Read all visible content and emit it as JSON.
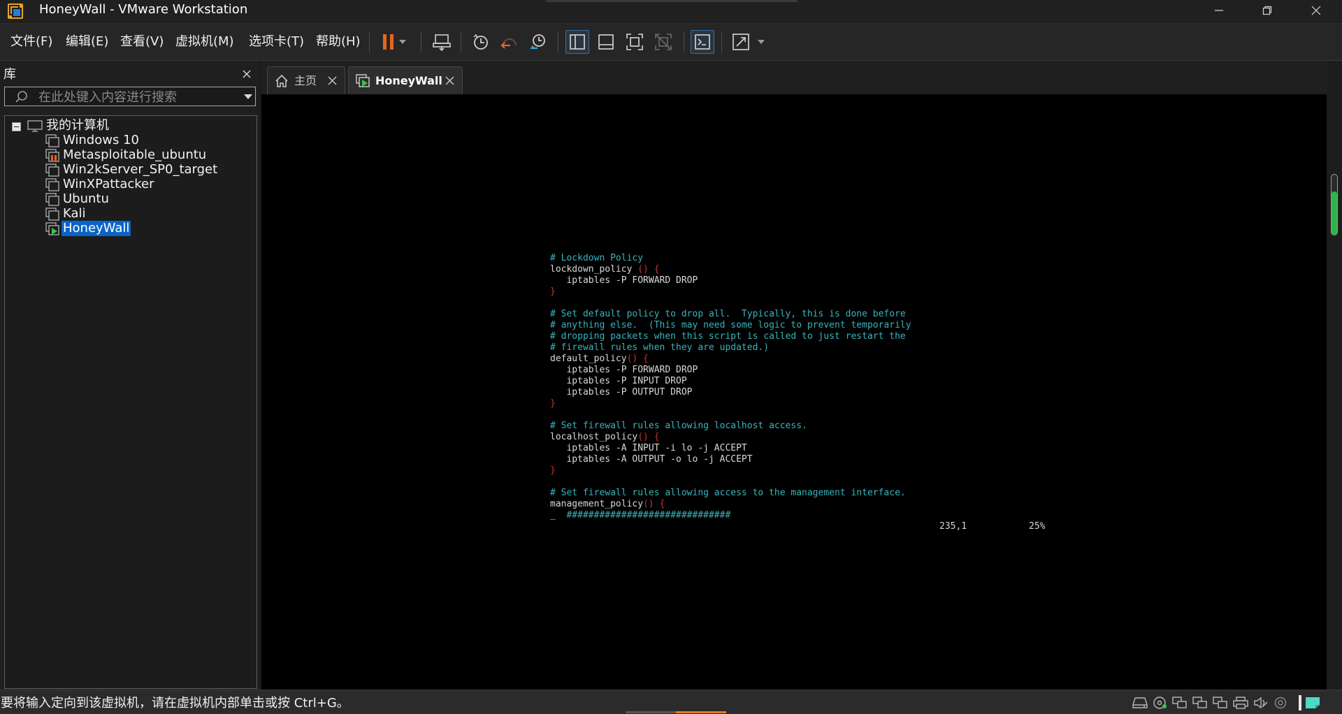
{
  "window": {
    "title": "HoneyWall - VMware Workstation"
  },
  "menu": {
    "items": [
      "文件(F)",
      "编辑(E)",
      "查看(V)",
      "虚拟机(M)",
      "选项卡(T)",
      "帮助(H)"
    ]
  },
  "toolbar": {
    "icons": [
      "pause-icon",
      "dropdown-arrow-icon",
      "send-ctrl-alt-del-icon",
      "snapshot-icon",
      "revert-snapshot-icon",
      "snapshot-manager-icon",
      "show-library-icon",
      "show-thumbnail-bar-icon",
      "fullscreen-icon",
      "unity-icon",
      "console-view-icon",
      "stretch-guest-icon"
    ],
    "accent_color": "#e8641e"
  },
  "library": {
    "title": "库",
    "search_placeholder": "在此处键入内容进行搜索",
    "root_label": "我的计算机",
    "vms": [
      {
        "label": "Windows 10",
        "state": "off"
      },
      {
        "label": "Metasploitable_ubuntu",
        "state": "paused"
      },
      {
        "label": "Win2kServer_SP0_target",
        "state": "off"
      },
      {
        "label": "WinXPattacker",
        "state": "off"
      },
      {
        "label": "Ubuntu",
        "state": "off"
      },
      {
        "label": "Kali",
        "state": "off"
      },
      {
        "label": "HoneyWall",
        "state": "running",
        "selected": true
      }
    ]
  },
  "tabs": [
    {
      "label": "主页",
      "active": false
    },
    {
      "label": "HoneyWall",
      "active": true
    }
  ],
  "console": {
    "lines": [
      {
        "t": "# Lockdown Policy",
        "c": "comment"
      },
      {
        "t": "lockdown_policy",
        "brace": " () {"
      },
      {
        "t": "   iptables -P FORWARD DROP"
      },
      {
        "t": "",
        "brace": "}"
      },
      {
        "t": ""
      },
      {
        "t": "# Set default policy to drop all.  Typically, this is done before",
        "c": "comment"
      },
      {
        "t": "# anything else.  (This may need some logic to prevent temporarily",
        "c": "comment"
      },
      {
        "t": "# dropping packets when this script is called to just restart the",
        "c": "comment"
      },
      {
        "t": "# firewall rules when they are updated.)",
        "c": "comment"
      },
      {
        "t": "default_policy",
        "brace": "() {"
      },
      {
        "t": "   iptables -P FORWARD DROP"
      },
      {
        "t": "   iptables -P INPUT DROP"
      },
      {
        "t": "   iptables -P OUTPUT DROP"
      },
      {
        "t": "",
        "brace": "}"
      },
      {
        "t": ""
      },
      {
        "t": "# Set firewall rules allowing localhost access.",
        "c": "comment"
      },
      {
        "t": "localhost_policy",
        "brace": "() {"
      },
      {
        "t": "   iptables -A INPUT -i lo -j ACCEPT"
      },
      {
        "t": "   iptables -A OUTPUT -o lo -j ACCEPT"
      },
      {
        "t": "",
        "brace": "}"
      },
      {
        "t": ""
      },
      {
        "t": "# Set firewall rules allowing access to the management interface.",
        "c": "comment"
      },
      {
        "t": "management_policy",
        "brace": "() {"
      },
      {
        "t": "_",
        "hash": "  ##############################"
      }
    ],
    "cursor_position": "235,1",
    "scroll_percent": "25%",
    "colors": {
      "comment": "#38b4bc",
      "brace": "#c83232",
      "text": "#d8d8d8"
    }
  },
  "statusbar": {
    "message": "要将输入定向到该虚拟机，请在虚拟机内部单击或按 Ctrl+G。",
    "icons": [
      "hard-disk-icon",
      "cd-dvd-icon",
      "network-adapter-icon",
      "network-adapter-icon",
      "network-adapter-icon",
      "printer-icon",
      "sound-icon",
      "usb-icon",
      "message-log-icon"
    ]
  },
  "scrollbar": {
    "accent_color": "#2fb34a"
  }
}
